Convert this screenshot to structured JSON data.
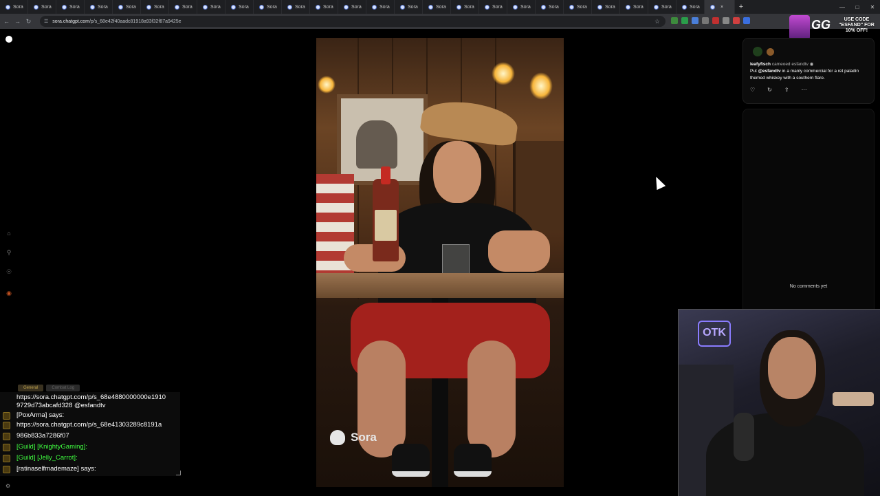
{
  "browser": {
    "tabs": [
      "Sora",
      "Sora",
      "Sora",
      "Sora",
      "Sora",
      "Sora",
      "Sora",
      "Sora",
      "Sora",
      "Sora",
      "Sora",
      "Sora",
      "Sora",
      "Sora",
      "Sora",
      "Sora",
      "Sora",
      "Sora",
      "Sora",
      "Sora",
      "Sora",
      "Sora",
      "Sora",
      "Sora",
      "Sora",
      "Sora"
    ],
    "url_host": "sora.chatgpt.com",
    "url_path": "/p/s_68e42f40aadc81918a93f32f87a9425e"
  },
  "promo": {
    "brand": "GG",
    "text": "USE CODE \"ESFAND\" FOR 10% OFF!"
  },
  "video": {
    "watermark": "Sora"
  },
  "post": {
    "author": "leafyfisch",
    "action": "cameoed esfandtv",
    "caption_mention": "@esfandtv",
    "caption_pre": "Put",
    "caption_post": "in a manly commercial for a ret paladin themed whiskey with a southern flare."
  },
  "comments": {
    "empty_text": "No comments yet"
  },
  "webcam": {
    "sign": "OTK"
  },
  "chat": {
    "tabs": [
      {
        "label": "General",
        "active": true
      },
      {
        "label": "Combat Log",
        "active": false
      }
    ],
    "lines": [
      {
        "text": "https://sora.chatgpt.com/p/s_68e4880000000e1910",
        "type": "normal"
      },
      {
        "text": "9729d73abcafd328 @esfandtv",
        "type": "normal"
      },
      {
        "text": "[PoxArma] says:",
        "type": "normal"
      },
      {
        "text": "https://sora.chatgpt.com/p/s_68e41303289c8191a",
        "type": "normal"
      },
      {
        "text": "986b833a7286f07",
        "type": "normal"
      },
      {
        "text": "[Guild] [KnightyGaming]:",
        "type": "guild"
      },
      {
        "text": "[Guild] [Jelly_Carrot]:",
        "type": "guild"
      },
      {
        "text": "[ratinaselfmademaze] says:",
        "type": "normal"
      }
    ]
  }
}
